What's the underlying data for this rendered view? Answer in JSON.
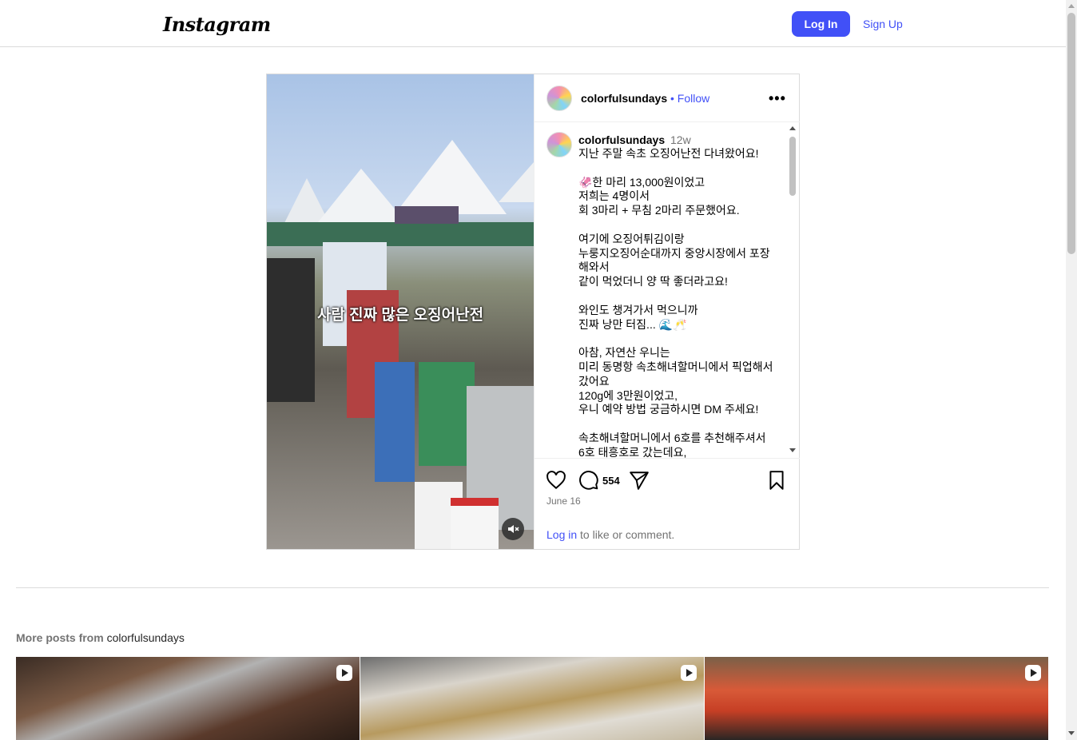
{
  "nav": {
    "logo": "Instagram",
    "login_label": "Log In",
    "signup_label": "Sign Up"
  },
  "post": {
    "username": "colorfulsundays",
    "follow_label": "• Follow",
    "media_caption": "사람 진짜 많은 오징어난전",
    "caption": {
      "username": "colorfulsundays",
      "time": "12w",
      "text": "지난 주말 속초 오징어난전 다녀왔어요!\n\n🦑한 마리 13,000원이었고\n저희는 4명이서\n회 3마리 + 무침 2마리 주문했어요.\n\n여기에 오징어튀김이랑\n누룽지오징어순대까지 중앙시장에서 포장해와서\n같이 먹었더니 양 딱 좋더라고요!\n\n와인도 챙겨가서 먹으니까\n진짜 낭만 터짐... 🌊🥂\n\n아참, 자연산 우니는\n미리 동명항 속초해녀할머니에서 픽업해서 갔어요\n120g에 3만원이었고,\n우니 예약 방법 궁금하시면 DM 주세요!\n\n속초해녀할머니에서 6호를 추천해주셔서\n6호 태흥호로 갔는데요,"
    },
    "comment_count": "554",
    "date": "June 16",
    "login_link": "Log in",
    "login_prompt_rest": " to like or comment."
  },
  "more_posts": {
    "prefix": "More posts from ",
    "username": "colorfulsundays"
  },
  "icons": {
    "heart": "heart-icon",
    "comment": "comment-icon",
    "share": "share-icon",
    "save": "save-icon",
    "more": "more-icon",
    "mute": "muted-speaker-icon",
    "reel": "reel-icon"
  },
  "colors": {
    "accent": "#4150f7",
    "secondary_text": "#737373",
    "border": "#dbdbdb"
  }
}
